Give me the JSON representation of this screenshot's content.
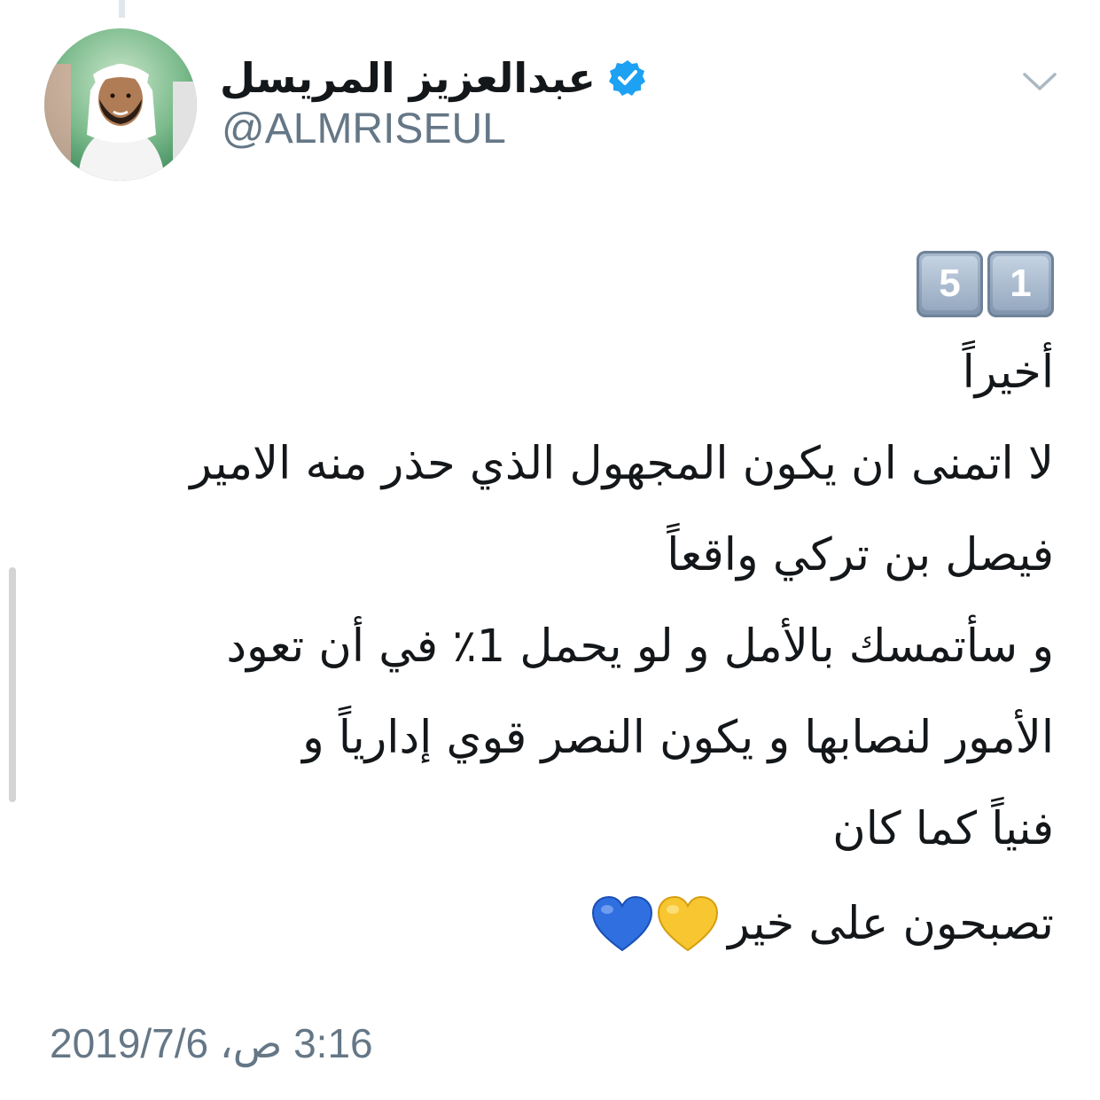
{
  "author": {
    "display_name": "عبدالعزيز المريسل",
    "handle": "@ALMRISEUL",
    "verified": true
  },
  "icons": {
    "avatar": "avatar-photo",
    "verified": "verified-badge-icon",
    "menu": "chevron-down-icon",
    "hearts": [
      "yellow-heart-icon",
      "blue-heart-icon"
    ]
  },
  "tweet": {
    "keycaps": [
      "1",
      "5"
    ],
    "lines": [
      "أخيراً",
      "لا اتمنى ان يكون المجهول الذي حذر منه الامير",
      "فيصل بن تركي واقعاً",
      "و سأتمسك بالأمل و لو يحمل 1٪ في أن تعود",
      "الأمور لنصابها و يكون النصر قوي إدارياً و",
      "فنياً كما كان"
    ],
    "closing": "تصبحون على خير"
  },
  "timestamp": "3:16 ص، 2019/7/6",
  "colors": {
    "text": "#14171a",
    "secondary": "#657786",
    "verified_blue": "#1da1f2",
    "heart_yellow": "#f7c631",
    "heart_blue": "#2f6fe0"
  }
}
